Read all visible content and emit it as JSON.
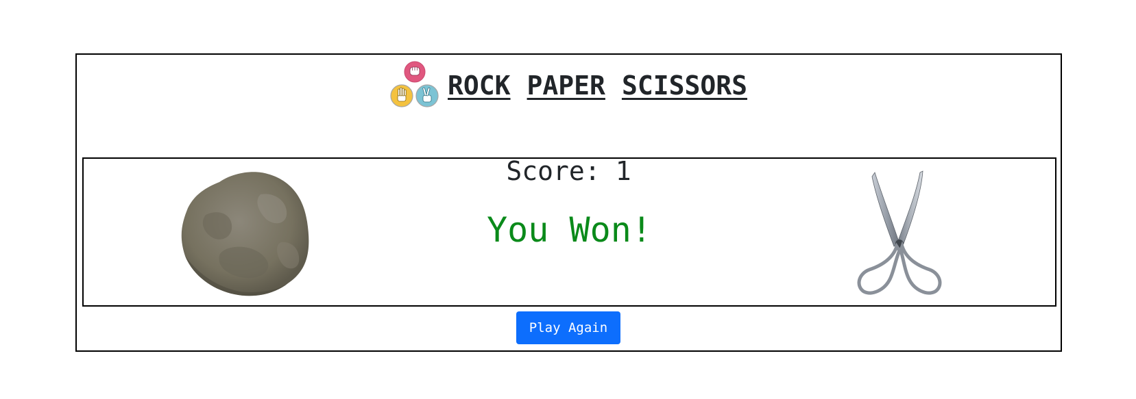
{
  "header": {
    "logo_icon": "rock-paper-scissors-logo",
    "title_words": [
      "ROCK",
      "PAPER",
      "SCISSORS"
    ]
  },
  "score": {
    "label": "Score:",
    "value": "1"
  },
  "round": {
    "player_choice": "rock",
    "computer_choice": "scissors",
    "result_text": "You Won!",
    "result_color": "#0a8a1a"
  },
  "actions": {
    "play_again_label": "Play Again",
    "button_color": "#0d6efd"
  },
  "colors": {
    "logo_rock": "#e0577f",
    "logo_paper": "#f4c23f",
    "logo_scissors": "#7cc3d4"
  }
}
